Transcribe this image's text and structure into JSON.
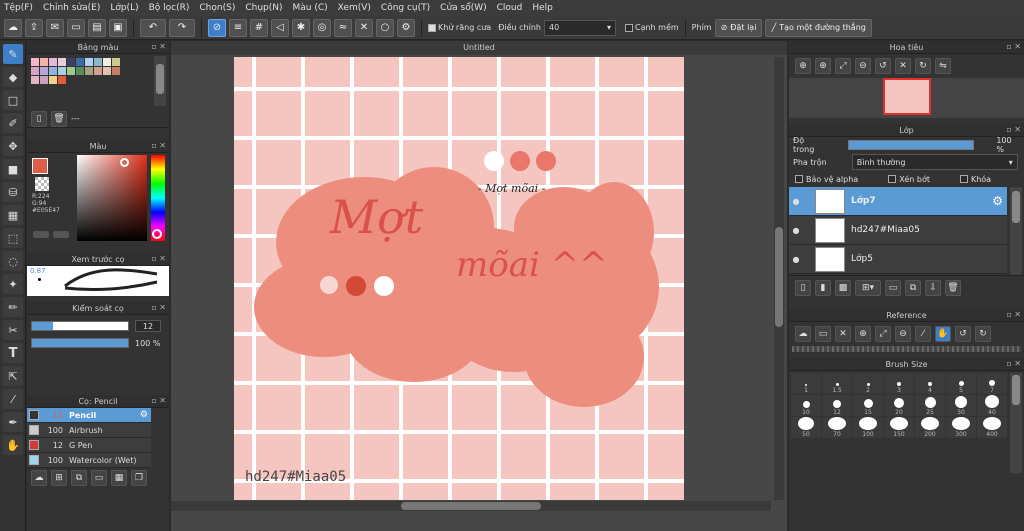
{
  "menu": [
    "Tệp(F)",
    "Chỉnh sửa(E)",
    "Lớp(L)",
    "Bộ lọc(R)",
    "Chọn(S)",
    "Chụp(N)",
    "Màu (C)",
    "Xem(V)",
    "Công cụ(T)",
    "Cửa sổ(W)",
    "Cloud",
    "Help"
  ],
  "toolbar": {
    "antialias_label": "Khử răng cưa",
    "adjust_label": "Điều chỉnh",
    "adjust_value": "40",
    "smooth_label": "Cạnh mềm",
    "keys_label": "Phím",
    "reset_label": "Đặt lại",
    "new_line_label": "Tạo một đường thẳng"
  },
  "left": {
    "palette_title": "Bảng màu",
    "palette_dashes": "---",
    "color_title": "Màu",
    "rgb": {
      "r": "R:224",
      "g": "G:94",
      "hex": "#E05E47"
    },
    "brush_preview_title": "Xem trước cọ",
    "brush_preview_size": "0.87",
    "brush_control_title": "Kiểm soát cọ",
    "brush_size_value": "12",
    "opacity_value": "100 %",
    "brush_list_title": "Cọ: Pencil",
    "brushes": [
      {
        "size": "12",
        "name": "Pencil",
        "color": "#333333",
        "selected": true
      },
      {
        "size": "100",
        "name": "Airbrush",
        "color": "#cccccc",
        "selected": false
      },
      {
        "size": "12",
        "name": "G Pen",
        "color": "#d33b3b",
        "selected": false
      },
      {
        "size": "100",
        "name": "Watercolor (Wet)",
        "color": "#9fd6ee",
        "selected": false
      }
    ],
    "palette_colors": [
      "#f4b8c8",
      "#f6b3a8",
      "#e7b7d9",
      "#e9d0dc",
      "#3b3f61",
      "#3d6ba6",
      "#b3d1ee",
      "#88b8c9",
      "#f1eee2",
      "#cbc98c",
      "#d6a4c8",
      "#b6a9d6",
      "#8fb3de",
      "#a9cfe3",
      "#9ccb8a",
      "#5a8d5b",
      "#a7a084",
      "#d1a18f",
      "#e0c4b0",
      "#c47f62",
      "#e0b6c3",
      "#c9a0c4",
      "#f0d18a",
      "#e35c3a"
    ]
  },
  "canvas": {
    "tab_title": "Untitled",
    "title_1": "Mợt",
    "title_2": "mõai ^^",
    "subtitle": "- Mợt mõai -",
    "watermark": "hd247#Miaa05"
  },
  "right": {
    "navigator_title": "Hoa tiêu",
    "layer_title": "Lớp",
    "opacity_label": "Độ trong",
    "opacity_value": "100 %",
    "blend_label": "Pha trộn",
    "blend_value": "Bình thường",
    "protect_alpha": "Bảo vệ alpha",
    "clip": "Xén bớt",
    "lock": "Khóa",
    "layers": [
      {
        "name": "Lớp7",
        "selected": true
      },
      {
        "name": "hd247#Miaa05",
        "selected": false
      },
      {
        "name": "Lớp5",
        "selected": false
      }
    ],
    "reference_title": "Reference",
    "brushsize_title": "Brush Size",
    "brush_sizes": [
      "1",
      "1.5",
      "2",
      "3",
      "4",
      "5",
      "7",
      "10",
      "12",
      "15",
      "20",
      "25",
      "30",
      "40",
      "50",
      "70",
      "100",
      "150",
      "200",
      "300",
      "400"
    ]
  }
}
